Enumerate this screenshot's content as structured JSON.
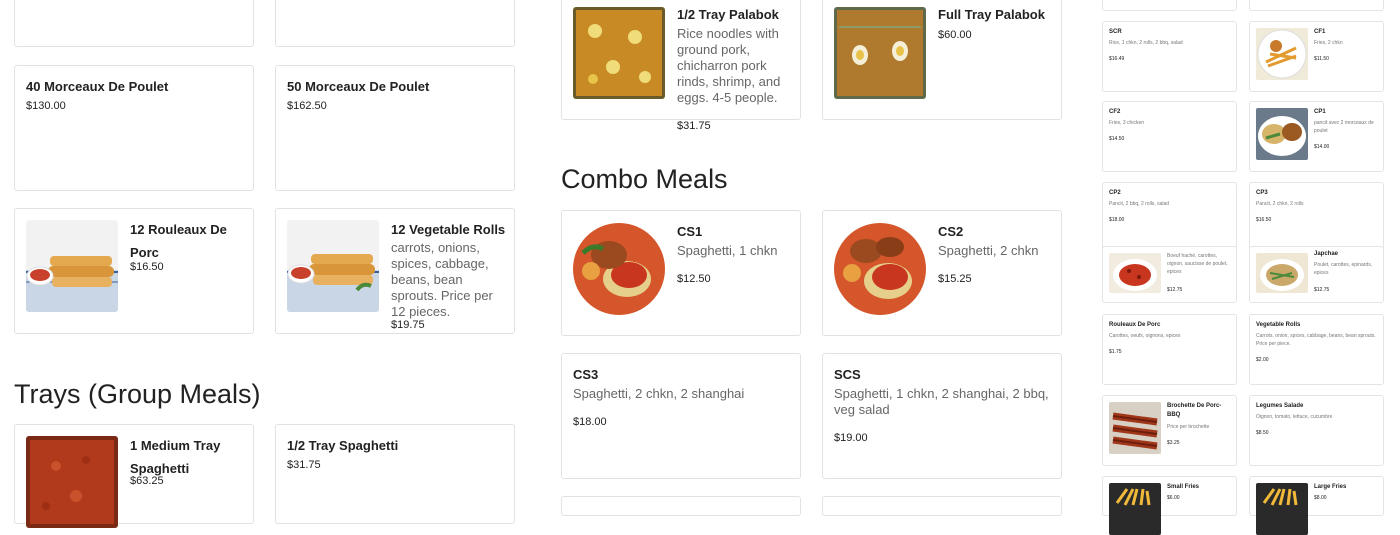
{
  "main": {
    "left_items": [
      {
        "name": "40 Morceaux De Poulet",
        "desc": "",
        "price": "$130.00"
      },
      {
        "name": "50 Morceaux De Poulet",
        "desc": "",
        "price": "$162.50"
      },
      {
        "name": "12 Rouleaux De Porc",
        "desc": "",
        "price": "$16.50"
      },
      {
        "name": "12 Vegetable Rolls",
        "desc": "carrots, onions, spices, cabbage, beans, bean sprouts. Price per 12 pieces.",
        "price": "$19.75"
      }
    ],
    "trays_heading": "Trays (Group Meals)",
    "trays": [
      {
        "name": "1 Medium Tray Spaghetti",
        "desc": "",
        "price": "$63.25"
      },
      {
        "name": "1/2 Tray Spaghetti",
        "desc": "",
        "price": "$31.75"
      }
    ],
    "palabok": [
      {
        "name": "1/2 Tray Palabok",
        "desc": "Rice noodles with ground pork, chicharron pork rinds, shrimp, and eggs. 4-5 people.",
        "price": "$31.75"
      },
      {
        "name": "Full Tray Palabok",
        "desc": "",
        "price": "$60.00"
      }
    ],
    "combo_heading": "Combo Meals",
    "combos": [
      {
        "name": "CS1",
        "desc": "Spaghetti, 1 chkn",
        "price": "$12.50"
      },
      {
        "name": "CS2",
        "desc": "Spaghetti, 2 chkn",
        "price": "$15.25"
      },
      {
        "name": "CS3",
        "desc": "Spaghetti, 2 chkn, 2 shanghai",
        "price": "$18.00"
      },
      {
        "name": "SCS",
        "desc": "Spaghetti, 1 chkn, 2 shanghai, 2 bbq, veg salad",
        "price": "$19.00"
      }
    ]
  },
  "side": {
    "items": [
      {
        "name": "SCR",
        "desc": "Rice, 1 chkn, 2 rolls, 2 bbq, salad",
        "price": "$16.49"
      },
      {
        "name": "CF1",
        "desc": "Fries, 2 chkn",
        "price": "$11.50"
      },
      {
        "name": "CF2",
        "desc": "Fries, 3 chicken",
        "price": "$14.50"
      },
      {
        "name": "CP1",
        "desc": "pancit avec 2 morceaux de poulet",
        "price": "$14.00"
      },
      {
        "name": "CP2",
        "desc": "Pancit, 2 bbq, 2 rolls, salad",
        "price": "$18.00"
      },
      {
        "name": "CP3",
        "desc": "Pancit, 2 chkn, 2 rolls",
        "price": "$16.50"
      },
      {
        "name": "",
        "desc": "Boeuf haché, carottes, oignon, saucisse de poulet, epices",
        "price": "$12.75"
      },
      {
        "name": "Japchae",
        "desc": "Poulet, carottes, epinards, epices",
        "price": "$12.75"
      },
      {
        "name": "Rouleaux De Porc",
        "desc": "Carottes, oeufs, oignons, epices",
        "price": "$1.75"
      },
      {
        "name": "Vegetable Rolls",
        "desc": "Carrots, onion, spices, cabbage, beans, bean sprouts. Price per piece.",
        "price": "$2.00"
      },
      {
        "name": "Brochette De Porc-BBQ",
        "desc": "Price per brochette",
        "price": "$3.25"
      },
      {
        "name": "Legumes Salade",
        "desc": "Oignon, tomato, lettuce, cucumbre",
        "price": "$8.50"
      },
      {
        "name": "Small Fries",
        "desc": "",
        "price": "$6.00"
      },
      {
        "name": "Large Fries",
        "desc": "",
        "price": "$8.00"
      }
    ]
  },
  "colors": {
    "border": "#e2e2e2",
    "text": "#222222",
    "muted": "#666666",
    "accent_orange": "#d4562a"
  }
}
